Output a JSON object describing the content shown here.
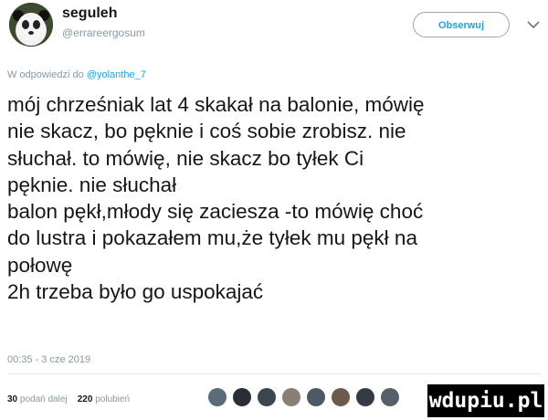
{
  "tweet": {
    "display_name": "seguleh",
    "handle": "@errareergosum",
    "follow_label": "Obserwuj",
    "reply_prefix": "W odpowiedzi do ",
    "reply_mention": "@yolanthe_7",
    "text": "mój chrześniak lat 4 skakał na balonie, mówię\nnie skacz, bo pęknie i coś sobie zrobisz. nie\nsłuchał. to mówię, nie skacz bo tyłek Ci\npęknie. nie słuchał\nbalon pękł,młody się zaciesza -to mówię choć\ndo lustra i pokazałem mu,że tyłek mu pękł na\npołowę\n2h trzeba było go uspokajać",
    "timestamp": "00:35 - 3 cze 2019"
  },
  "stats": {
    "retweets_count": "30",
    "retweets_label": "podań dalej",
    "likes_count": "220",
    "likes_label": "polubień"
  },
  "liker_avatars": [
    {
      "name": "liker-avatar",
      "color": "#5b6b7a"
    },
    {
      "name": "liker-avatar",
      "color": "#2a2f36"
    },
    {
      "name": "liker-avatar",
      "color": "#3c4651"
    },
    {
      "name": "liker-avatar",
      "color": "#8a7f72"
    },
    {
      "name": "liker-avatar",
      "color": "#4d5966"
    },
    {
      "name": "liker-avatar",
      "color": "#6c5a4e"
    },
    {
      "name": "liker-avatar",
      "color": "#343b44"
    },
    {
      "name": "liker-avatar",
      "color": "#56606b"
    }
  ],
  "watermark": "wdupiu.pl",
  "colors": {
    "accent": "#1da1f2",
    "muted": "#8899a6",
    "text": "#14171a"
  },
  "icons": {
    "avatar": "panda-avatar-icon",
    "menu": "chevron-down-icon"
  }
}
